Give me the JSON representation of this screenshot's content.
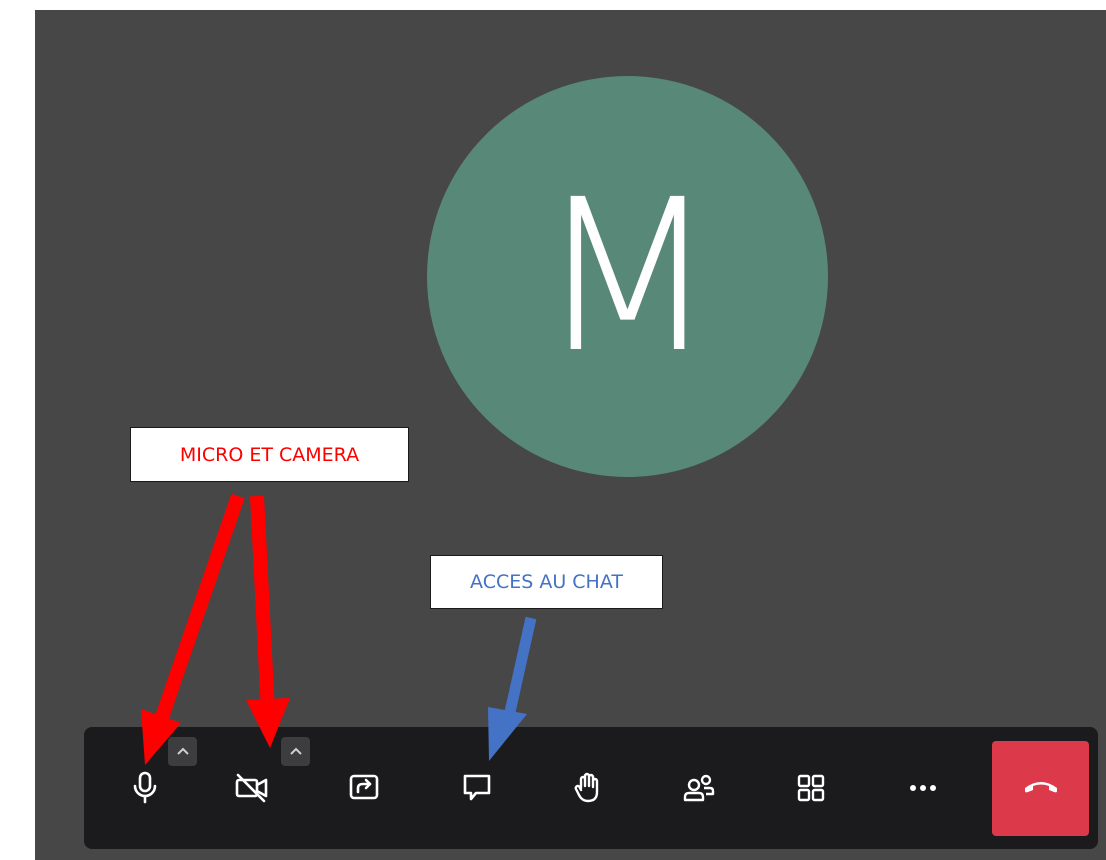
{
  "meeting": {
    "avatar_initial": "M",
    "avatar_color": "#588878",
    "stage_color": "#474747"
  },
  "annotations": {
    "mic_camera_label": "MICRO ET CAMERA",
    "mic_camera_color": "#ff0000",
    "chat_label": "ACCES AU CHAT",
    "chat_color": "#4472c4"
  },
  "toolbar": {
    "buttons": [
      {
        "icon": "microphone-icon"
      },
      {
        "icon": "camera-off-icon"
      },
      {
        "icon": "share-screen-icon"
      },
      {
        "icon": "chat-icon"
      },
      {
        "icon": "raise-hand-icon"
      },
      {
        "icon": "participants-icon"
      },
      {
        "icon": "grid-view-icon"
      },
      {
        "icon": "more-options-icon"
      },
      {
        "icon": "hang-up-icon"
      }
    ],
    "hangup_color": "#dc3a4a",
    "background": "#1b1b1d"
  }
}
